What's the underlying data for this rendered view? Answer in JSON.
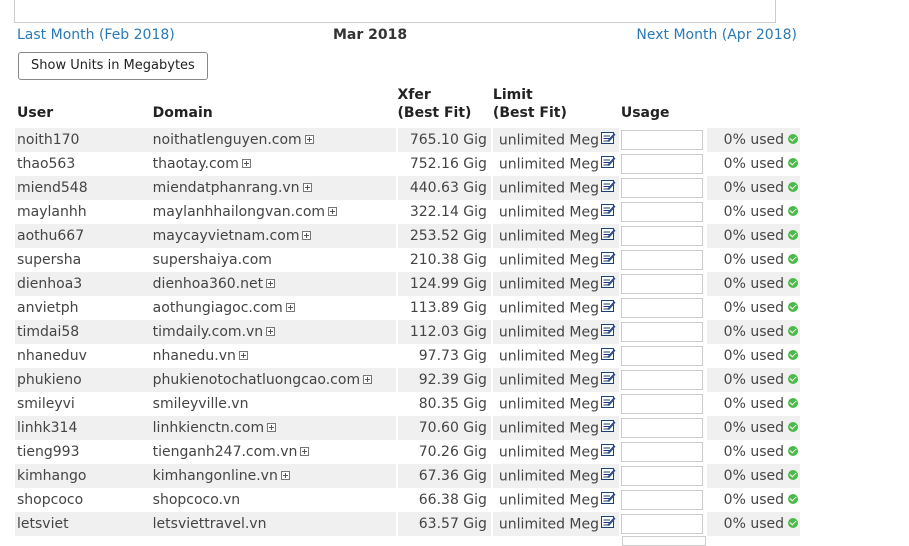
{
  "nav": {
    "prev": "Last Month (Feb 2018)",
    "current": "Mar 2018",
    "next": "Next Month (Apr 2018)"
  },
  "units_button": "Show Units in Megabytes",
  "headers": {
    "user": "User",
    "domain": "Domain",
    "xfer": "Xfer",
    "xfer_sub": "(Best Fit)",
    "limit": "Limit",
    "limit_sub": "(Best Fit)",
    "usage": "Usage"
  },
  "rows": [
    {
      "user": "noith170",
      "domain": "noithatlenguyen.com",
      "plus": true,
      "xfer": "765.10 Gig",
      "limit": "unlimited Meg",
      "usage": "0% used"
    },
    {
      "user": "thao563",
      "domain": "thaotay.com",
      "plus": true,
      "xfer": "752.16 Gig",
      "limit": "unlimited Meg",
      "usage": "0% used"
    },
    {
      "user": "miend548",
      "domain": "miendatphanrang.vn",
      "plus": true,
      "xfer": "440.63 Gig",
      "limit": "unlimited Meg",
      "usage": "0% used"
    },
    {
      "user": "maylanhh",
      "domain": "maylanhhailongvan.com",
      "plus": true,
      "xfer": "322.14 Gig",
      "limit": "unlimited Meg",
      "usage": "0% used"
    },
    {
      "user": "aothu667",
      "domain": "maycayvietnam.com",
      "plus": true,
      "xfer": "253.52 Gig",
      "limit": "unlimited Meg",
      "usage": "0% used"
    },
    {
      "user": "supersha",
      "domain": "supershaiya.com",
      "plus": false,
      "xfer": "210.38 Gig",
      "limit": "unlimited Meg",
      "usage": "0% used"
    },
    {
      "user": "dienhoa3",
      "domain": "dienhoa360.net",
      "plus": true,
      "xfer": "124.99 Gig",
      "limit": "unlimited Meg",
      "usage": "0% used"
    },
    {
      "user": "anvietph",
      "domain": "aothungiagoc.com",
      "plus": true,
      "xfer": "113.89 Gig",
      "limit": "unlimited Meg",
      "usage": "0% used"
    },
    {
      "user": "timdai58",
      "domain": "timdaily.com.vn",
      "plus": true,
      "xfer": "112.03 Gig",
      "limit": "unlimited Meg",
      "usage": "0% used"
    },
    {
      "user": "nhaneduv",
      "domain": "nhanedu.vn",
      "plus": true,
      "xfer": "97.73 Gig",
      "limit": "unlimited Meg",
      "usage": "0% used"
    },
    {
      "user": "phukieno",
      "domain": "phukienotochatluongcao.com",
      "plus": true,
      "xfer": "92.39 Gig",
      "limit": "unlimited Meg",
      "usage": "0% used"
    },
    {
      "user": "smileyvi",
      "domain": "smileyville.vn",
      "plus": false,
      "xfer": "80.35 Gig",
      "limit": "unlimited Meg",
      "usage": "0% used"
    },
    {
      "user": "linhk314",
      "domain": "linhkienctn.com",
      "plus": true,
      "xfer": "70.60 Gig",
      "limit": "unlimited Meg",
      "usage": "0% used"
    },
    {
      "user": "tieng993",
      "domain": "tienganh247.com.vn",
      "plus": true,
      "xfer": "70.26 Gig",
      "limit": "unlimited Meg",
      "usage": "0% used"
    },
    {
      "user": "kimhango",
      "domain": "kimhangonline.vn",
      "plus": true,
      "xfer": "67.36 Gig",
      "limit": "unlimited Meg",
      "usage": "0% used"
    },
    {
      "user": "shopcoco",
      "domain": "shopcoco.vn",
      "plus": false,
      "xfer": "66.38 Gig",
      "limit": "unlimited Meg",
      "usage": "0% used"
    },
    {
      "user": "letsviet",
      "domain": "letsviettravel.vn",
      "plus": false,
      "xfer": "63.57 Gig",
      "limit": "unlimited Meg",
      "usage": "0% used"
    }
  ],
  "icons": {
    "expand": "plus-box-icon",
    "edit": "edit-note-icon",
    "status": "check-circle-icon"
  },
  "colors": {
    "link": "#2a7ab8",
    "row_stripe": "#f0f0f0",
    "status_ok": "#4cba4a"
  }
}
